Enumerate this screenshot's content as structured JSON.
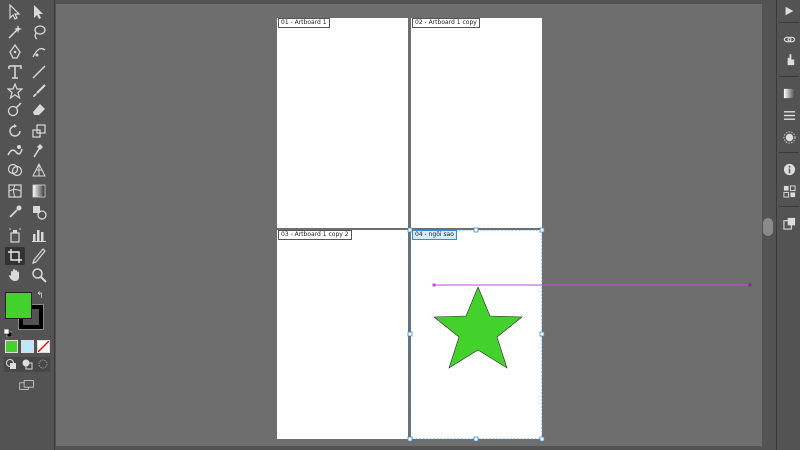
{
  "artboards": [
    {
      "label": "01 - Artboard 1"
    },
    {
      "label": "02 - Artboard 1 copy"
    },
    {
      "label": "03 - Artboard 1 copy 2"
    },
    {
      "label": "04 - ngôi sao"
    }
  ],
  "colors": {
    "fill": "#43d12c",
    "stroke": "#000000",
    "selection": "#3a8ad8",
    "guide": "#c24fd1",
    "canvas": "#6e6e6e"
  },
  "tools": {
    "left_column": [
      "selection-icon",
      "magic-wand-icon",
      "pen-icon",
      "type-icon",
      "star-tool-icon",
      "shaper-icon",
      "rotate-icon",
      "warp-icon",
      "shape-builder-icon",
      "mesh-icon",
      "eyedropper-icon",
      "artboard-tool-icon",
      "hand-icon"
    ],
    "right_column": [
      "direct-selection-icon",
      "lasso-icon",
      "curvature-icon",
      "line-segment-icon",
      "paintbrush-icon",
      "eraser-icon",
      "scale-icon",
      "puppet-warp-icon",
      "perspective-grid-icon",
      "gradient-icon",
      "blend-icon",
      "column-graph-icon",
      "slice-icon",
      "zoom-icon"
    ]
  }
}
